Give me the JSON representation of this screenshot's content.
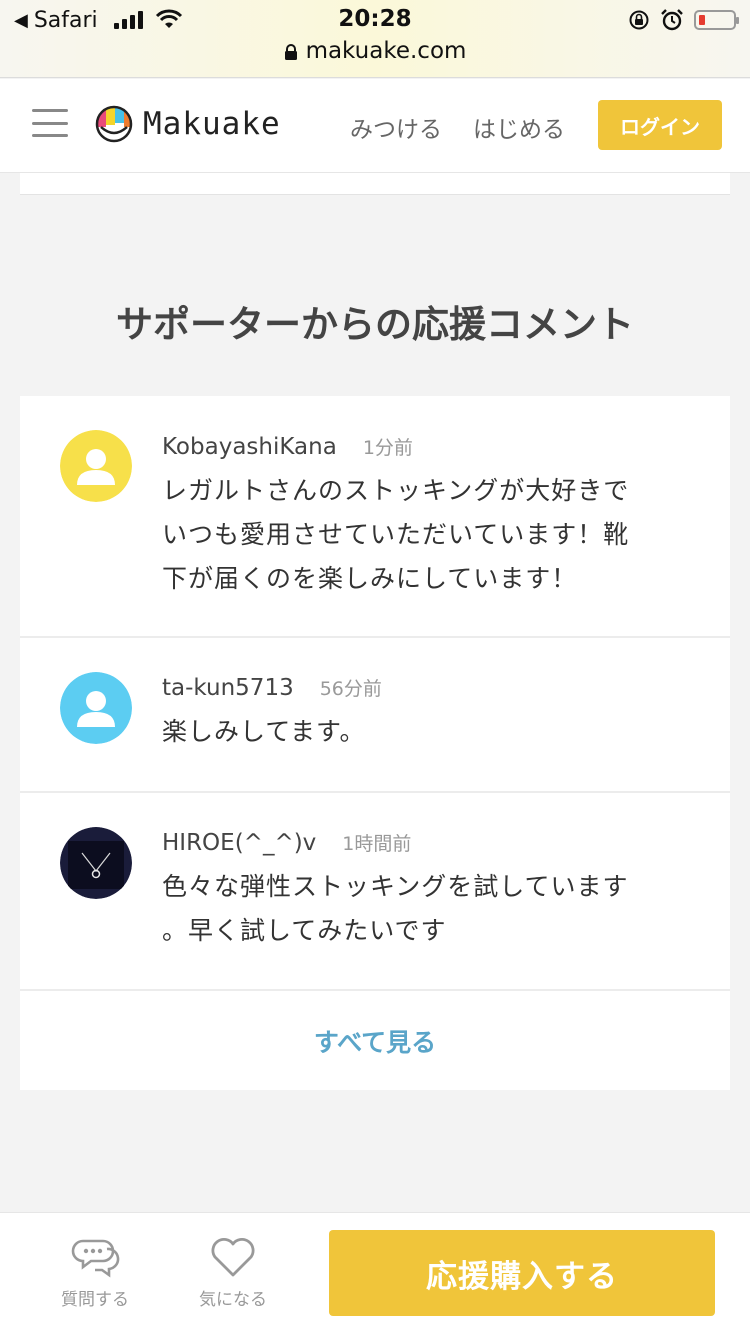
{
  "status_bar": {
    "back_label": "Safari",
    "time": "20:28",
    "url": "makuake.com"
  },
  "header": {
    "logo_text": "Makuake",
    "nav": [
      {
        "label": "みつける"
      },
      {
        "label": "はじめる"
      }
    ],
    "login_label": "ログイン"
  },
  "section": {
    "title": "サポーターからの応援コメント"
  },
  "comments": [
    {
      "user": "KobayashiKana",
      "time": "1分前",
      "text_lines": [
        "レガルトさんのストッキングが大好きで",
        "いつも愛用させていただいています！靴",
        "下が届くのを楽しみにしています！"
      ],
      "avatar_color": "#f7e04a"
    },
    {
      "user": "ta-kun5713",
      "time": "56分前",
      "text_lines": [
        "楽しみしてます。"
      ],
      "avatar_color": "#5ccdf2"
    },
    {
      "user": "HIROE(^_^)v",
      "time": "1時間前",
      "text_lines": [
        "色々な弾性ストッキングを試しています",
        "。早く試してみたいです"
      ],
      "avatar_color": "#1a1c3a"
    }
  ],
  "see_all_label": "すべて見る",
  "bottom_bar": {
    "question_label": "質問する",
    "favorite_label": "気になる",
    "support_label": "応援購入する"
  },
  "colors": {
    "accent_yellow": "#f0c53a",
    "link_blue": "#5aa5c9",
    "battery_low": "#e53b30"
  }
}
